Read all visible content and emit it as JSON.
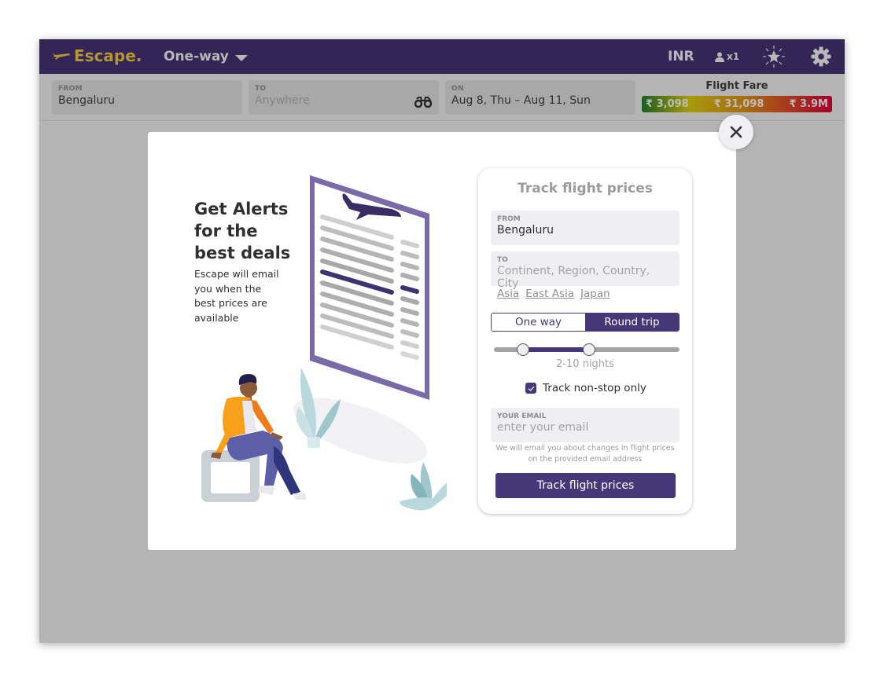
{
  "header": {
    "brand": "Escape.",
    "trip_type": "One-way",
    "currency": "INR",
    "passengers": "x1",
    "icons": [
      "plane-icon",
      "chevron-down-icon",
      "person-icon",
      "star-icon",
      "gear-icon"
    ],
    "colors": {
      "bar_bg": "#332656",
      "brand": "#b3962f"
    }
  },
  "search": {
    "from": {
      "label": "FROM",
      "value": "Bengaluru"
    },
    "to": {
      "label": "TO",
      "placeholder": "Anywhere"
    },
    "on": {
      "label": "ON",
      "value": "Aug 8, Thu – Aug 11, Sun"
    },
    "fare": {
      "title": "Flight Fare",
      "low": "₹ 3,098",
      "mid": "₹ 31,098",
      "high": "₹ 3.9M"
    }
  },
  "modal": {
    "promo": {
      "title_lines": [
        "Get Alerts",
        "for the",
        "best deals"
      ],
      "text": "Escape will email you when the best prices are available"
    },
    "card": {
      "title": "Track flight prices",
      "from": {
        "label": "FROM",
        "value": "Bengaluru"
      },
      "to": {
        "label": "TO",
        "placeholder": "Continent, Region, Country, City"
      },
      "suggestions": [
        "Asia",
        "East Asia",
        "Japan"
      ],
      "trip_toggle": {
        "options": [
          "One way",
          "Round trip"
        ],
        "selected": "Round trip"
      },
      "nights_range": {
        "label": "2-10 nights",
        "min": 2,
        "max": 10
      },
      "nonstop": {
        "label": "Track non-stop only",
        "checked": true
      },
      "email": {
        "label": "YOUR EMAIL",
        "placeholder": "enter your email"
      },
      "disclaimer": "We will email you about changes in flight prices on the provided email address",
      "submit_label": "Track flight prices",
      "accent": "#463878"
    }
  }
}
